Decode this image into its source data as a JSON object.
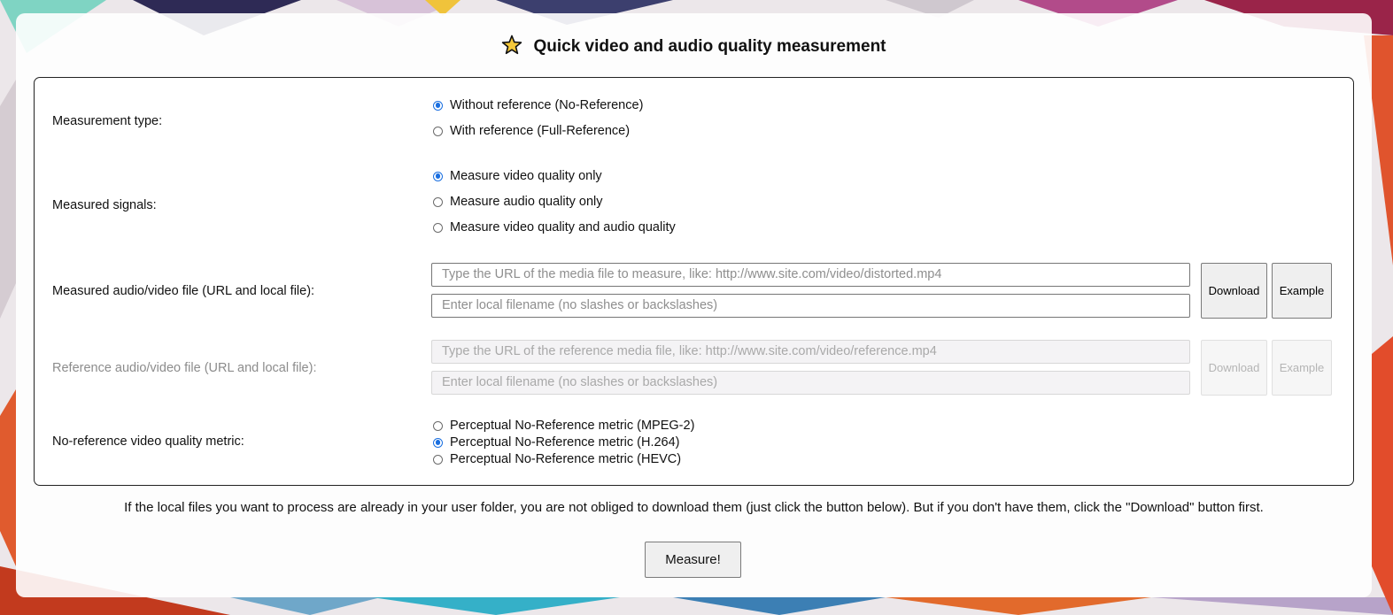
{
  "page": {
    "title": "Quick video and audio quality measurement",
    "accent_color": "#1a6fe0"
  },
  "measurement_type": {
    "label": "Measurement type:",
    "options": [
      {
        "label": "Without reference (No-Reference)",
        "checked": true
      },
      {
        "label": "With reference (Full-Reference)",
        "checked": false
      }
    ]
  },
  "measured_signals": {
    "label": "Measured signals:",
    "options": [
      {
        "label": "Measure video quality only",
        "checked": true
      },
      {
        "label": "Measure audio quality only",
        "checked": false
      },
      {
        "label": "Measure video quality and audio quality",
        "checked": false
      }
    ]
  },
  "measured_file": {
    "label": "Measured audio/video file (URL and local file):",
    "url_placeholder": "Type the URL of the media file to measure, like: http://www.site.com/video/distorted.mp4",
    "local_placeholder": "Enter local filename (no slashes or backslashes)",
    "download_label": "Download",
    "example_label": "Example"
  },
  "reference_file": {
    "label": "Reference audio/video file (URL and local file):",
    "url_placeholder": "Type the URL of the reference media file, like: http://www.site.com/video/reference.mp4",
    "local_placeholder": "Enter local filename (no slashes or backslashes)",
    "download_label": "Download",
    "example_label": "Example",
    "disabled": true
  },
  "nr_metric": {
    "label": "No-reference video quality metric:",
    "options": [
      {
        "label": "Perceptual No-Reference metric (MPEG-2)",
        "checked": false
      },
      {
        "label": "Perceptual No-Reference metric (H.264)",
        "checked": true
      },
      {
        "label": "Perceptual No-Reference metric (HEVC)",
        "checked": false
      }
    ]
  },
  "note": "If the local files you want to process are already in your user folder, you are not obliged to download them (just click the button below). But if you don't have them, click the \"Download\" button first.",
  "measure_button": "Measure!"
}
